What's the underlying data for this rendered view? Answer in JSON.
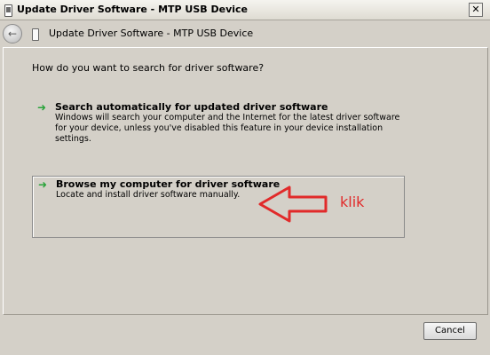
{
  "window": {
    "title": "Update Driver Software - MTP USB Device",
    "close_label": "✕"
  },
  "nav": {
    "title": "Update Driver Software - MTP USB Device"
  },
  "main": {
    "question": "How do you want to search for driver software?",
    "options": [
      {
        "title": "Search automatically for updated driver software",
        "description": "Windows will search your computer and the Internet for the latest driver software for your device, unless you've disabled this feature in your device installation settings."
      },
      {
        "title": "Browse my computer for driver software",
        "description": "Locate and install driver software manually."
      }
    ]
  },
  "annotation": {
    "text": "klik",
    "color": "#e12a2a"
  },
  "footer": {
    "cancel_label": "Cancel"
  },
  "icons": {
    "back": "back-arrow-icon",
    "device": "usb-device-icon",
    "option_arrow": "green-arrow-icon",
    "close": "close-icon"
  }
}
